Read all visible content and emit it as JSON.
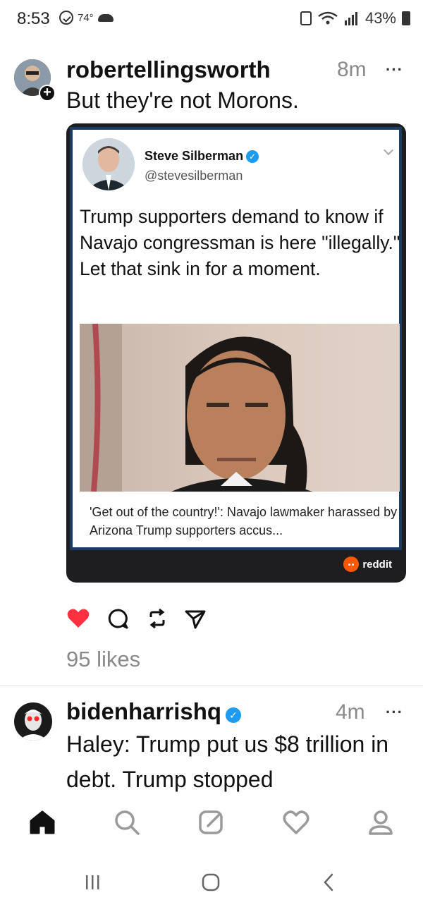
{
  "status_bar": {
    "time": "8:53",
    "temperature": "74°",
    "battery_percent": "43%",
    "icons": [
      "message-icon",
      "cloud-icon",
      "lock-icon",
      "wifi-icon",
      "signal-icon",
      "battery-icon"
    ]
  },
  "post1": {
    "username": "robertellingsworth",
    "time_ago": "8m",
    "more": "···",
    "text": "But they're not Morons.",
    "embed": {
      "tweet_name": "Steve Silberman",
      "tweet_handle": "@stevesilberman",
      "tweet_text": "Trump supporters demand to know if Navajo congressman is here \"illegally.\" Let that sink in for a moment.",
      "news_caption": "'Get out of the country!': Navajo lawmaker harassed by Arizona Trump supporters accus...",
      "source": "reddit"
    },
    "liked": true,
    "likes": "95 likes"
  },
  "post2": {
    "username": "bidenharrishq",
    "time_ago": "4m",
    "more": "···",
    "text": "Haley: Trump put us $8 trillion in debt. Trump stopped",
    "verified": true
  },
  "nav": {
    "items": [
      "home-icon",
      "search-icon",
      "compose-icon",
      "activity-icon",
      "profile-icon"
    ],
    "active": "home-icon"
  },
  "colors": {
    "like_red": "#ff3040",
    "verified_blue": "#1d9bf0",
    "reddit_orange": "#ff5700",
    "card_border": "#1c3d63"
  }
}
